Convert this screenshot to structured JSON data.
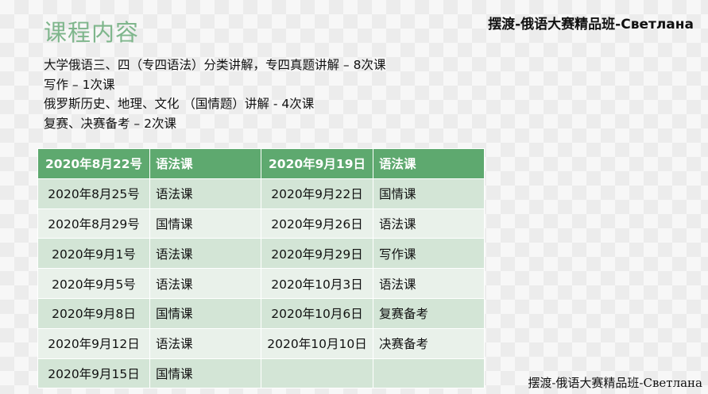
{
  "title": "课程内容",
  "brand": "摆渡-俄语大赛精品班-Светлана",
  "intro_lines": [
    "大学俄语三、四（专四语法）分类讲解，专四真题讲解 – 8次课",
    "写作 – 1次课",
    "俄罗斯历史、地理、文化 （国情题）讲解 - 4次课",
    "复赛、决赛备考 – 2次课"
  ],
  "table": {
    "header": [
      "2020年8月22号",
      "语法课",
      "2020年9月19日",
      "语法课"
    ],
    "rows": [
      [
        "2020年8月25号",
        "语法课",
        "2020年9月22日",
        "国情课"
      ],
      [
        "2020年8月29号",
        "国情课",
        "2020年9月26日",
        "语法课"
      ],
      [
        "2020年9月1号",
        "语法课",
        "2020年9月29日",
        "写作课"
      ],
      [
        "2020年9月5号",
        "语法课",
        "2020年10月3日",
        "语法课"
      ],
      [
        "2020年9月8日",
        "国情课",
        "2020年10月6日",
        "复赛备考"
      ],
      [
        "2020年9月12日",
        "语法课",
        "2020年10月10日",
        "决赛备考"
      ],
      [
        "2020年9月15日",
        "国情课",
        "",
        ""
      ]
    ]
  }
}
